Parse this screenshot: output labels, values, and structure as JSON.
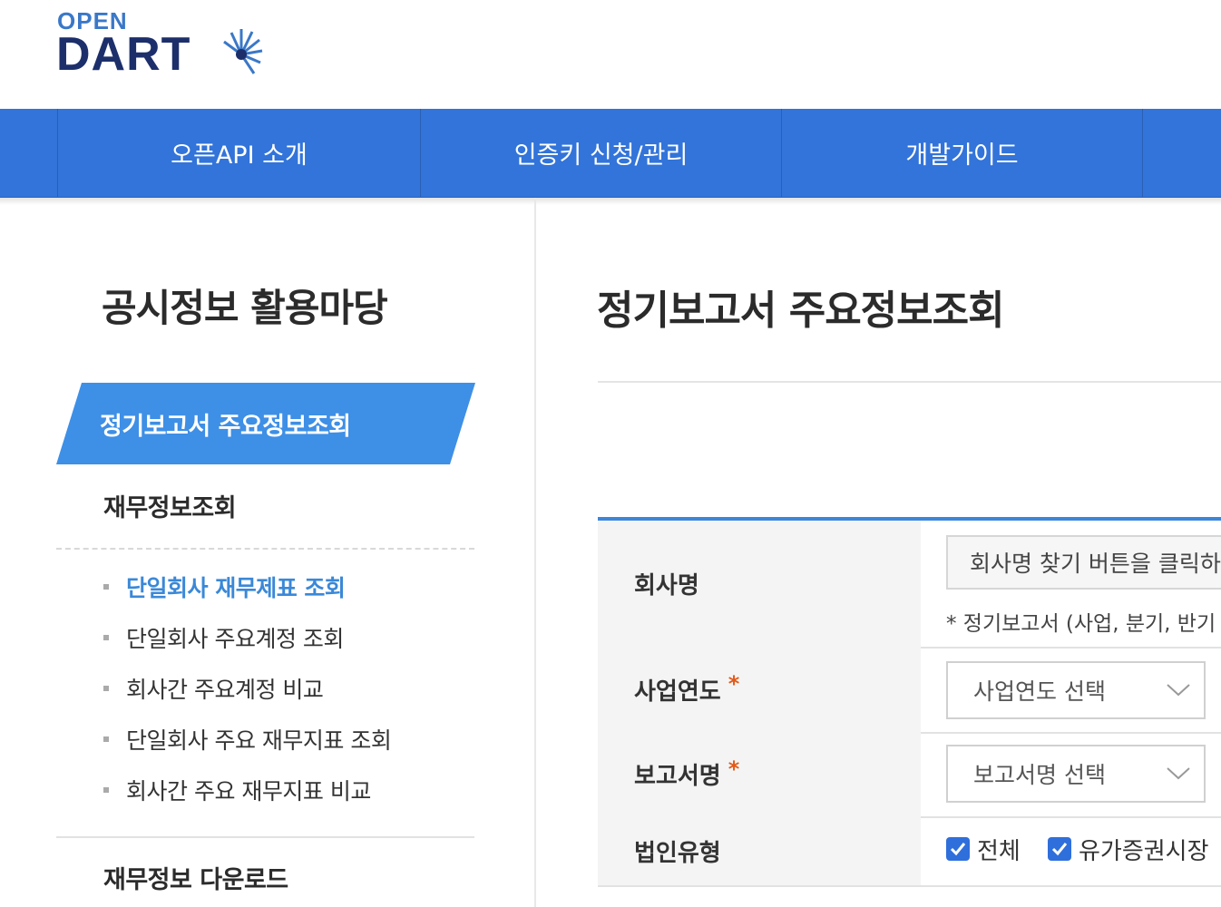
{
  "header": {
    "logo_top": "OPEN",
    "logo_main": "DART"
  },
  "gnb": {
    "items": [
      {
        "label": "오픈API 소개"
      },
      {
        "label": "인증키 신청/관리"
      },
      {
        "label": "개발가이드"
      }
    ]
  },
  "sidebar": {
    "title": "공시정보 활용마당",
    "active_menu": "정기보고서 주요정보조회",
    "section1": "재무정보조회",
    "subitems": [
      {
        "label": "단일회사 재무제표 조회"
      },
      {
        "label": "단일회사 주요계정 조회"
      },
      {
        "label": "회사간 주요계정 비교"
      },
      {
        "label": "단일회사 주요 재무지표 조회"
      },
      {
        "label": "회사간 주요 재무지표 비교"
      }
    ],
    "section2": "재무정보 다운로드"
  },
  "content": {
    "title": "정기보고서 주요정보조회",
    "form": {
      "company": {
        "label": "회사명",
        "placeholder": "회사명 찾기 버튼을 클릭하",
        "note": "* 정기보고서 (사업, 분기, 반기"
      },
      "year": {
        "label": "사업연도",
        "required": "*",
        "value": "사업연도 선택"
      },
      "report": {
        "label": "보고서명",
        "required": "*",
        "value": "보고서명 선택"
      },
      "corp_type": {
        "label": "법인유형",
        "options": [
          {
            "label": "전체",
            "checked": true
          },
          {
            "label": "유가증권시장",
            "checked": true
          }
        ]
      }
    }
  },
  "colors": {
    "gnb": "#3274d9",
    "active": "#3e8fe6",
    "accent_text": "#3a88d8",
    "required": "#e25a1a"
  }
}
